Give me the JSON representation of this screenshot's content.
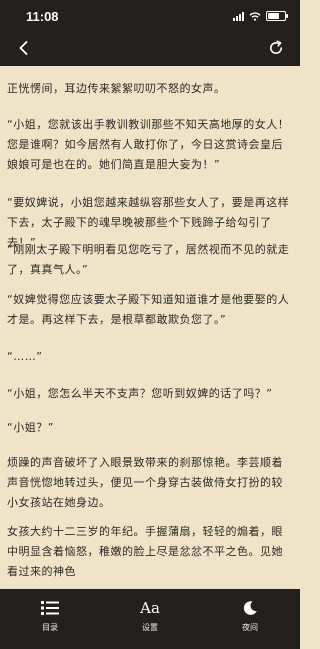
{
  "status_bar": {
    "time": "11:08",
    "battery_level": 0.7
  },
  "header": {
    "back_icon": "chevron-left-icon",
    "refresh_icon": "refresh-icon"
  },
  "article": {
    "paragraphs": [
      "正恍愣间，耳边传来絮絮叨叨不怒的女声。",
      "“小姐，您就该出手教训教训那些不知天高地厚的女人！您是谁啊？如今居然有人敢打你了，今日这赏诗会皇后娘娘可是也在的。她们简直是胆大妄为！”",
      "“要奴婢说，小姐您越来越纵容那些女人了，要是再这样下去，太子殿下的魂早晚被那些个下贱蹄子给勾引了去！”",
      "“刚刚太子殿下明明看见您吃亏了，居然视而不见的就走了，真真气人。”",
      "“奴婢觉得您应该要太子殿下知道知道谁才是他要娶的人才是。再这样下去，是根草都敢欺负您了。”",
      "“……”",
      "“小姐，您怎么半天不支声？您听到奴婢的话了吗？”",
      "“小姐？”",
      "烦躁的声音破坏了入眼景致带来的刹那惊艳。李芸顺着声音恍惚地转过头，便见一个身穿古装做侍女打扮的较小女孩站在她身边。",
      "女孩大约十二三岁的年纪。手握蒲扇，轻轻的煽着，眼中明显含着恼怒，稚嫩的脸上尽是忿忿不平之色。见她看过来的神色"
    ]
  },
  "toolbar": {
    "menu_label": "目录",
    "settings_label": "设置",
    "settings_glyph": "Aa",
    "night_label": "夜间"
  }
}
